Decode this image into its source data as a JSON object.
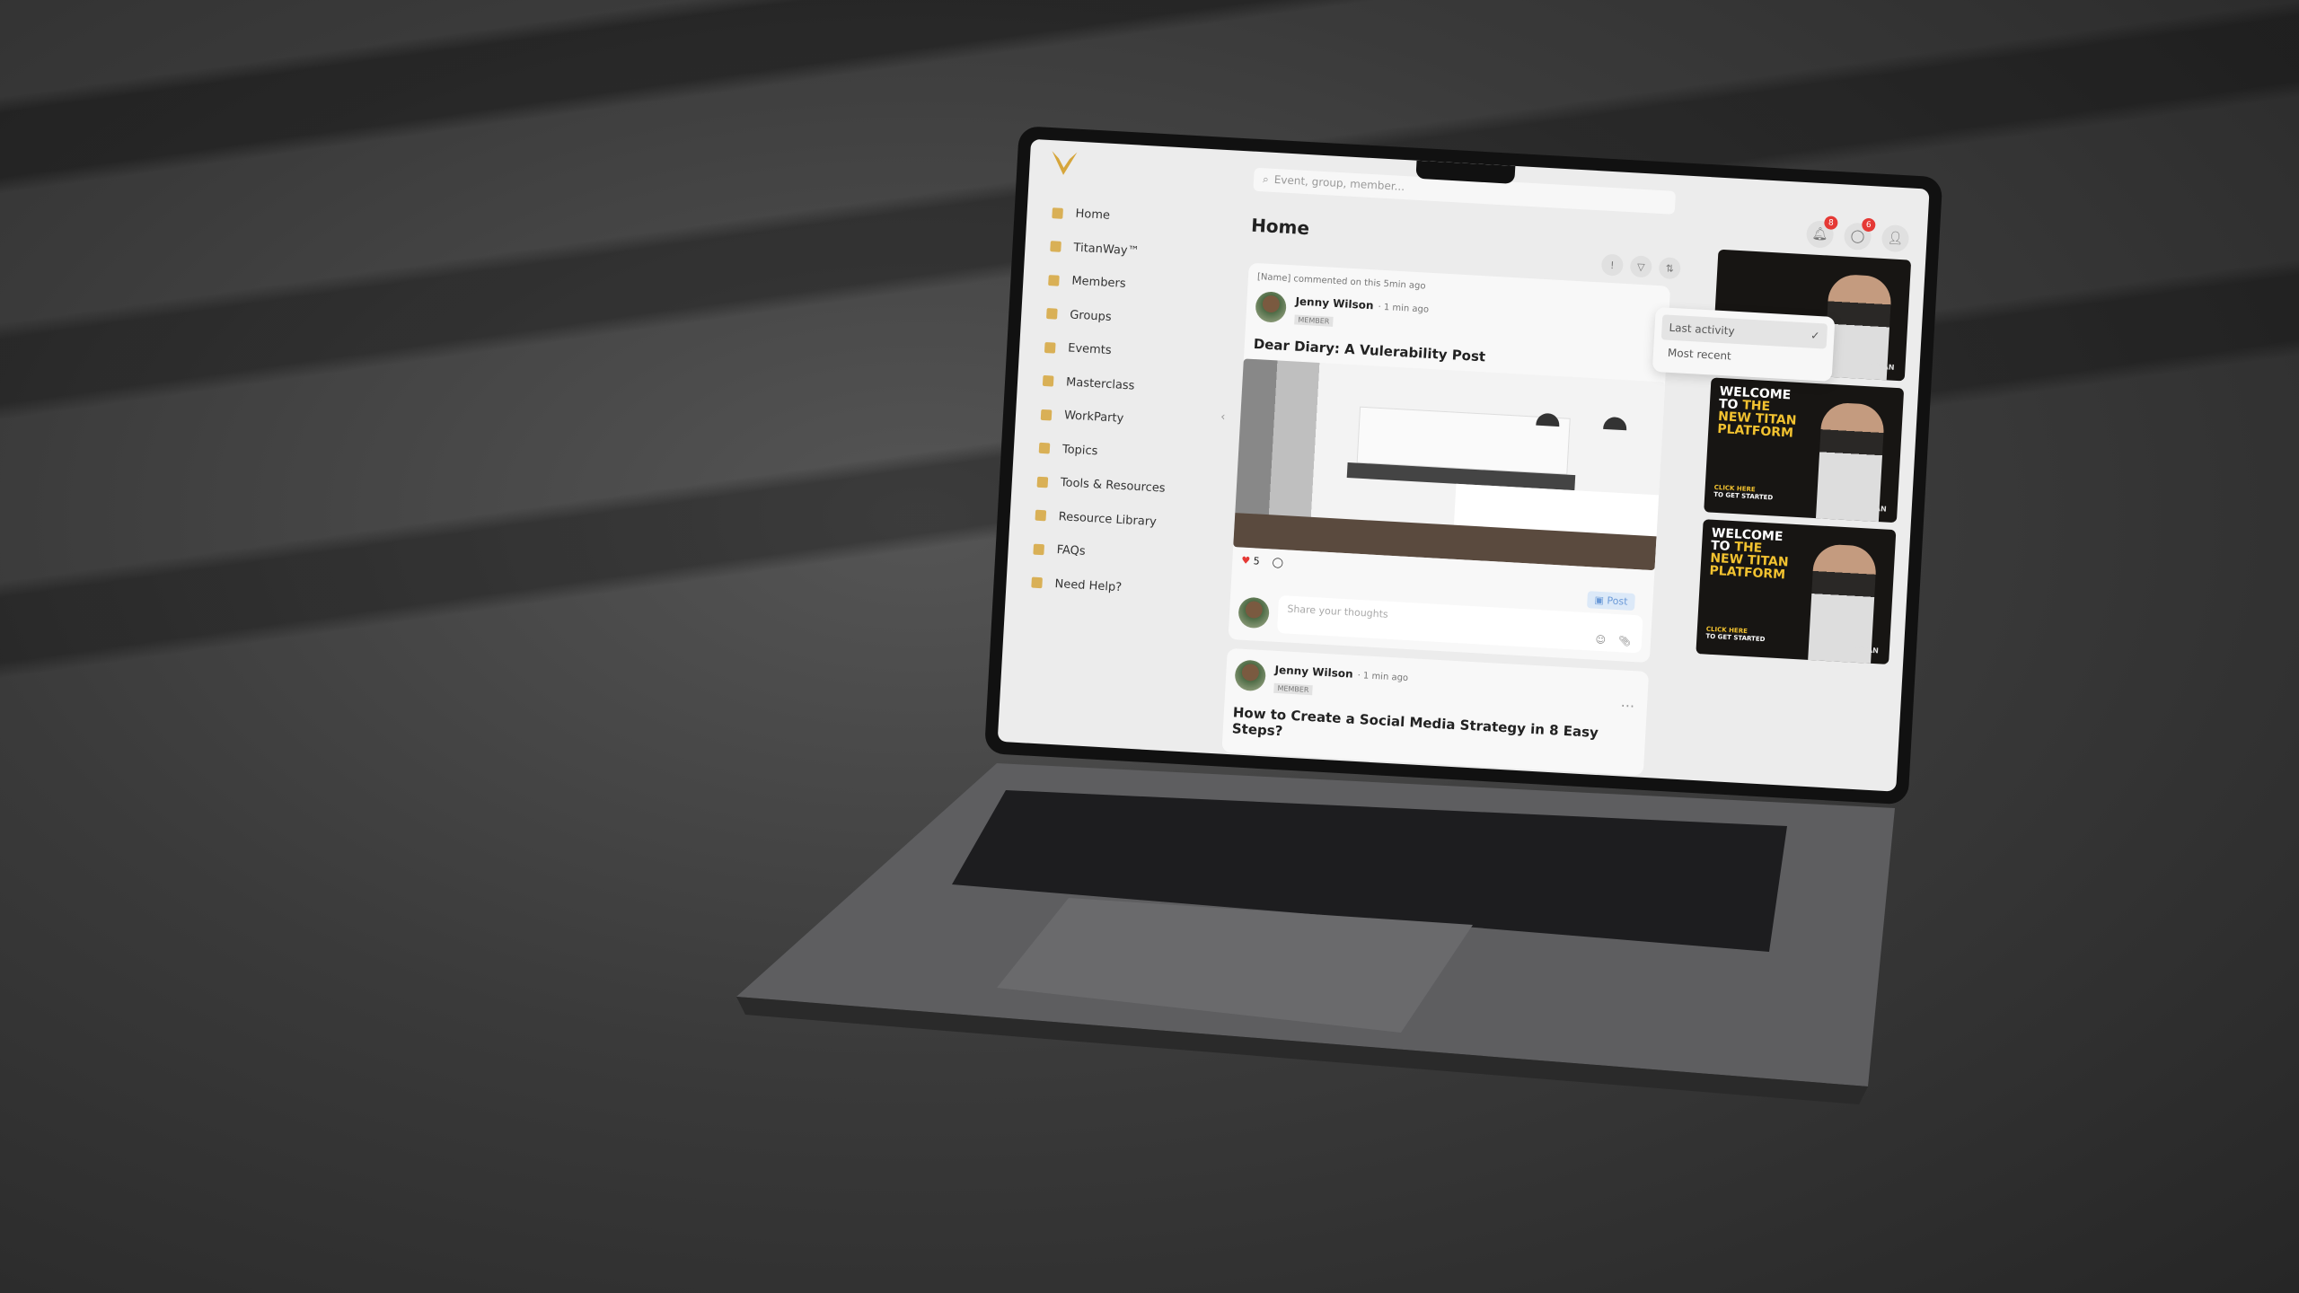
{
  "search": {
    "placeholder": "Event, group, member..."
  },
  "header": {
    "notifications_count": "8",
    "messages_count": "6"
  },
  "sidebar": {
    "items": [
      {
        "label": "Home"
      },
      {
        "label": "TitanWay™"
      },
      {
        "label": "Members"
      },
      {
        "label": "Groups"
      },
      {
        "label": "Evemts"
      },
      {
        "label": "Masterclass"
      },
      {
        "label": "WorkParty"
      },
      {
        "label": "Topics"
      },
      {
        "label": "Tools & Resources"
      },
      {
        "label": "Resource Library"
      },
      {
        "label": "FAQs"
      },
      {
        "label": "Need Help?"
      }
    ]
  },
  "main": {
    "title": "Home",
    "sort": {
      "options": [
        "Last activity",
        "Most recent"
      ],
      "selected": "Last activity"
    },
    "posts": [
      {
        "activity": "[Name] commented on this 5min ago",
        "author": "Jenny Wilson",
        "time": "· 1 min ago",
        "role": "MEMBER",
        "title": "Dear Diary: A Vulerability Post",
        "likes": "5"
      },
      {
        "author": "Jenny Wilson",
        "time": "· 1 min ago",
        "role": "MEMBER",
        "title": "How to Create a Social Media Strategy in 8 Easy Steps?"
      }
    ],
    "composer": {
      "placeholder": "Share your thoughts",
      "post_label": "Post"
    }
  },
  "banners": {
    "line1": "WELCOME",
    "line2a": "TO ",
    "line2b": "THE",
    "line3": "NEW TITAN",
    "line4": "PLATFORM",
    "cta1": "CLICK HERE",
    "cta2": "TO GET STARTED",
    "brand": "TITAN"
  },
  "colors": {
    "accent": "#d6a63c",
    "badge": "#e53935",
    "banner_bg": "#171513",
    "banner_highlight": "#f2c230"
  }
}
